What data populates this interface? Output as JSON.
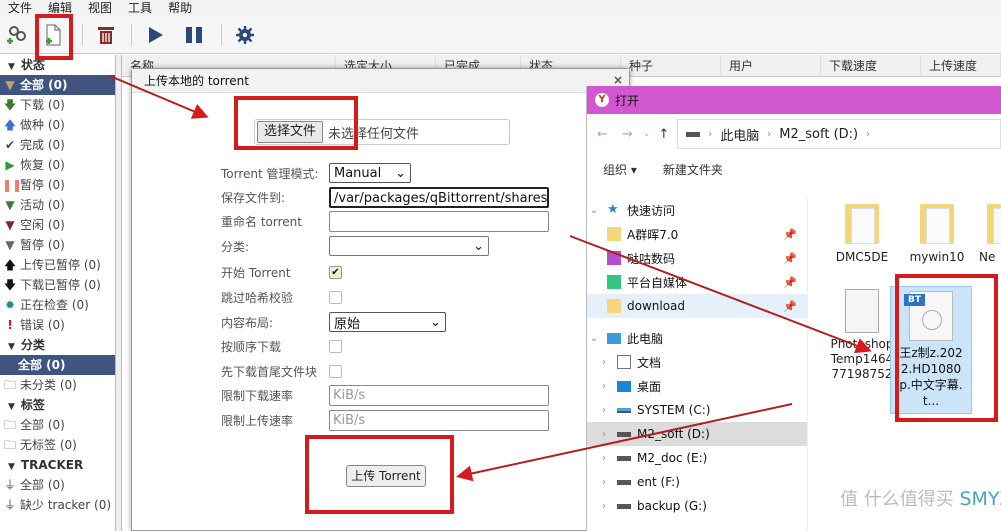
{
  "menubar": {
    "items": [
      "文件",
      "编辑",
      "视图",
      "工具",
      "帮助"
    ]
  },
  "toolbar": {
    "icons": [
      "add-link-icon",
      "add-file-icon",
      "delete-icon",
      "resume-icon",
      "pause-icon",
      "settings-icon"
    ]
  },
  "sidebar": {
    "status_header": "状态",
    "status_items": [
      {
        "label": "全部 (0)",
        "icon": "filter-icon",
        "selected": true
      },
      {
        "label": "下载 (0)",
        "icon": "arrow-down-icon"
      },
      {
        "label": "做种 (0)",
        "icon": "arrow-up-icon"
      },
      {
        "label": "完成 (0)",
        "icon": "check-icon"
      },
      {
        "label": "恢复 (0)",
        "icon": "play-icon"
      },
      {
        "label": "暂停 (0)",
        "icon": "pause-icon"
      },
      {
        "label": "活动 (0)",
        "icon": "filter-icon"
      },
      {
        "label": "空闲 (0)",
        "icon": "filter-icon"
      },
      {
        "label": "暂停 (0)",
        "icon": "filter-icon"
      },
      {
        "label": "上传已暂停 (0)",
        "icon": "arrow-up-icon"
      },
      {
        "label": "下载已暂停 (0)",
        "icon": "arrow-down-icon"
      },
      {
        "label": "正在检查 (0)",
        "icon": "gear-icon"
      },
      {
        "label": "错误 (0)",
        "icon": "error-icon"
      }
    ],
    "category_header": "分类",
    "category_items": [
      {
        "label": "全部 (0)",
        "selected": true
      },
      {
        "label": "未分类 (0)"
      }
    ],
    "tag_header": "标签",
    "tag_items": [
      {
        "label": "全部 (0)"
      },
      {
        "label": "无标签 (0)"
      }
    ],
    "tracker_header": "TRACKER",
    "tracker_items": [
      {
        "label": "全部 (0)"
      },
      {
        "label": "缺少 tracker (0)"
      }
    ]
  },
  "columns": [
    "名称",
    "选定大小",
    "已完成",
    "状态",
    "种子",
    "用户",
    "下载速度",
    "上传速度"
  ],
  "dialog": {
    "title": "上传本地的 torrent",
    "close": "×",
    "choose_file_label": "选择文件",
    "no_file_text": "未选择任何文件",
    "fields": {
      "mode_label": "Torrent 管理模式:",
      "mode_value": "Manual",
      "save_label": "保存文件到:",
      "save_value": "/var/packages/qBittorrent/shares/Do",
      "rename_label": "重命名 torrent",
      "rename_value": "",
      "category_label": "分类:",
      "category_value": "",
      "start_label": "开始 Torrent",
      "start_checked": true,
      "skip_check_label": "跳过哈希校验",
      "skip_check_checked": false,
      "layout_label": "内容布局:",
      "layout_value": "原始",
      "sequential_label": "按顺序下载",
      "sequential_checked": false,
      "first_last_label": "先下载首尾文件块",
      "first_last_checked": false,
      "dl_limit_label": "限制下载速率",
      "dl_limit_placeholder": "KiB/s",
      "ul_limit_label": "限制上传速率",
      "ul_limit_placeholder": "KiB/s"
    },
    "upload_button": "上传 Torrent"
  },
  "open_dialog": {
    "title": "打开",
    "breadcrumb": [
      "此电脑",
      "M2_soft (D:)"
    ],
    "organize": "组织 ▾",
    "new_folder": "新建文件夹",
    "quick_access": "快速访问",
    "quick_items": [
      "A群晖7.0",
      "哒咕数码",
      "平台自媒体",
      "download"
    ],
    "this_pc": "此电脑",
    "pc_items": [
      "文档",
      "桌面",
      "SYSTEM (C:)",
      "M2_soft (D:)",
      "M2_doc (E:)",
      "ent (F:)",
      "backup (G:)"
    ],
    "files": [
      {
        "name": "DMC5DE",
        "type": "folder"
      },
      {
        "name": "mywin10",
        "type": "folder"
      },
      {
        "name": "Ne",
        "type": "folder"
      },
      {
        "name": "Photoshop Temp146477198752",
        "type": "file"
      },
      {
        "name": "王z制z.2022.HD1080p.中文字幕.t...",
        "type": "torrent",
        "tag": "BT"
      }
    ]
  },
  "watermark": {
    "text": "值 什么值得买",
    "site": "SMYZ.NET"
  },
  "colors": {
    "accent_red": "#d51c1c",
    "selected_blue": "#3f5580",
    "title_magenta": "#d157d1"
  }
}
